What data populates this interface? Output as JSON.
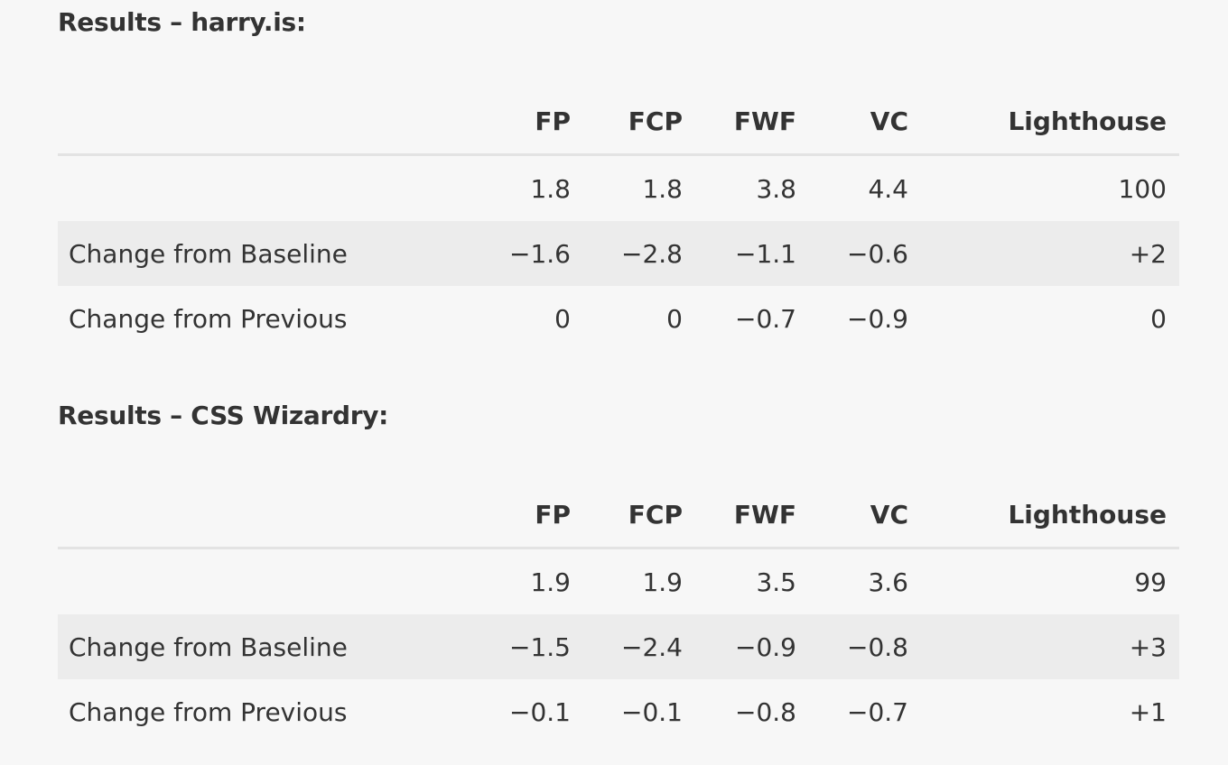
{
  "sections": [
    {
      "heading": "Results – harry.is:",
      "columns": [
        "FP",
        "FCP",
        "FWF",
        "VC",
        "Lighthouse"
      ],
      "rows": [
        {
          "label": "",
          "values": [
            "1.8",
            "1.8",
            "3.8",
            "4.4",
            "100"
          ]
        },
        {
          "label": "Change from Baseline",
          "values": [
            "−1.6",
            "−2.8",
            "−1.1",
            "−0.6",
            "+2"
          ]
        },
        {
          "label": "Change from Previous",
          "values": [
            "0",
            "0",
            "−0.7",
            "−0.9",
            "0"
          ]
        }
      ]
    },
    {
      "heading": "Results – CSS Wizardry:",
      "columns": [
        "FP",
        "FCP",
        "FWF",
        "VC",
        "Lighthouse"
      ],
      "rows": [
        {
          "label": "",
          "values": [
            "1.9",
            "1.9",
            "3.5",
            "3.6",
            "99"
          ]
        },
        {
          "label": "Change from Baseline",
          "values": [
            "−1.5",
            "−2.4",
            "−0.9",
            "−0.8",
            "+3"
          ]
        },
        {
          "label": "Change from Previous",
          "values": [
            "−0.1",
            "−0.1",
            "−0.8",
            "−0.7",
            "+1"
          ]
        }
      ]
    }
  ],
  "colors": {
    "background": "#f7f7f7",
    "text": "#333333",
    "shaded_row": "#ececec",
    "header_rule": "#e3e3e3"
  }
}
